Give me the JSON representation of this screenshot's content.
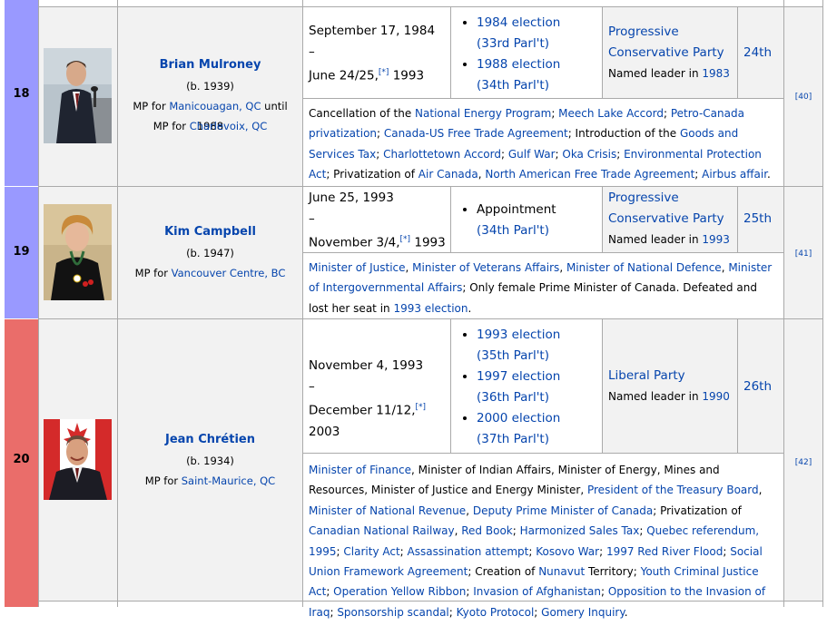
{
  "colors": {
    "pc_party": "#9999ff",
    "liberal_party": "#ea6d6a",
    "link": "#0645ad",
    "cell_bg": "#f2f2f2",
    "border": "#aaaaaa"
  },
  "rows": [
    {
      "number": "18",
      "name": "Brian Mulroney",
      "born": "(b. 1939)",
      "mp_lines": [
        {
          "prefix": "MP for ",
          "link": "Manicouagan, QC",
          "suffix": " until 1988"
        },
        {
          "prefix": "MP for ",
          "link": "Charlevoix, QC",
          "suffix": ""
        }
      ],
      "term_start": "September 17, 1984",
      "term_dash": "–",
      "term_end": "June 24/25,",
      "term_end_sup": "[*]",
      "term_end_year": " 1993",
      "elections": [
        {
          "election": "1984 election",
          "parl": "(33rd Parl't)"
        },
        {
          "election": "1988 election",
          "parl": "(34th Parl't)"
        }
      ],
      "party": "Progressive Conservative Party",
      "leader_prefix": "Named leader in ",
      "leader_year": "1983",
      "ministry": "24th",
      "ref": "[40]",
      "notes": [
        {
          "t": "Cancellation of the ",
          "l": false
        },
        {
          "t": "National Energy Program",
          "l": true
        },
        {
          "t": "; ",
          "l": false
        },
        {
          "t": "Meech Lake Accord",
          "l": true
        },
        {
          "t": "; ",
          "l": false
        },
        {
          "t": "Petro-Canada privatization",
          "l": true
        },
        {
          "t": "; ",
          "l": false
        },
        {
          "t": "Canada-US Free Trade Agreement",
          "l": true
        },
        {
          "t": "; Introduction of the ",
          "l": false
        },
        {
          "t": "Goods and Services Tax",
          "l": true
        },
        {
          "t": "; ",
          "l": false
        },
        {
          "t": "Charlottetown Accord",
          "l": true
        },
        {
          "t": "; ",
          "l": false
        },
        {
          "t": "Gulf War",
          "l": true
        },
        {
          "t": "; ",
          "l": false
        },
        {
          "t": "Oka Crisis",
          "l": true
        },
        {
          "t": "; ",
          "l": false
        },
        {
          "t": "Environmental Protection Act",
          "l": true
        },
        {
          "t": "; Privatization of ",
          "l": false
        },
        {
          "t": "Air Canada",
          "l": true
        },
        {
          "t": ", ",
          "l": false
        },
        {
          "t": "North American Free Trade Agreement",
          "l": true
        },
        {
          "t": "; ",
          "l": false
        },
        {
          "t": "Airbus affair",
          "l": true
        },
        {
          "t": ".",
          "l": false
        }
      ]
    },
    {
      "number": "19",
      "name": "Kim Campbell",
      "born": "(b. 1947)",
      "mp_lines": [
        {
          "prefix": "MP for ",
          "link": "Vancouver Centre, BC",
          "suffix": ""
        }
      ],
      "term_start": "June 25, 1993",
      "term_dash": "–",
      "term_end": "November 3/4,",
      "term_end_sup": "[*]",
      "term_end_year": " 1993",
      "elections": [
        {
          "election": "Appointment",
          "election_plain": true,
          "parl": "(34th Parl't)"
        }
      ],
      "party": "Progressive Conservative Party",
      "leader_prefix": "Named leader in ",
      "leader_year": "1993",
      "ministry": "25th",
      "ref": "[41]",
      "notes": [
        {
          "t": "Minister of Justice",
          "l": true
        },
        {
          "t": ", ",
          "l": false
        },
        {
          "t": "Minister of Veterans Affairs",
          "l": true
        },
        {
          "t": ", ",
          "l": false
        },
        {
          "t": "Minister of National Defence",
          "l": true
        },
        {
          "t": ", ",
          "l": false
        },
        {
          "t": "Minister of Intergovernmental Affairs",
          "l": true
        },
        {
          "t": "; Only female Prime Minister of Canada. Defeated and lost her seat in ",
          "l": false
        },
        {
          "t": "1993 election",
          "l": true
        },
        {
          "t": ".",
          "l": false
        }
      ]
    },
    {
      "number": "20",
      "name": "Jean Chrétien",
      "born": "(b. 1934)",
      "mp_lines": [
        {
          "prefix": "MP for ",
          "link": "Saint-Maurice, QC",
          "suffix": ""
        }
      ],
      "term_start": "November 4, 1993",
      "term_dash": "–",
      "term_end": "December 11/12,",
      "term_end_sup": "[*]",
      "term_end_year": " 2003",
      "elections": [
        {
          "election": "1993 election",
          "parl": "(35th Parl't)"
        },
        {
          "election": "1997 election",
          "parl": "(36th Parl't)"
        },
        {
          "election": "2000 election",
          "parl": "(37th Parl't)"
        }
      ],
      "party": "Liberal Party",
      "leader_prefix": "Named leader in ",
      "leader_year": "1990",
      "ministry": "26th",
      "ref": "[42]",
      "notes": [
        {
          "t": "Minister of Finance",
          "l": true
        },
        {
          "t": ", Minister of Indian Affairs, Minister of Energy, Mines and Resources, Minister of Justice and Energy Minister, ",
          "l": false
        },
        {
          "t": "President of the Treasury Board",
          "l": true
        },
        {
          "t": ", ",
          "l": false
        },
        {
          "t": "Minister of National Revenue",
          "l": true
        },
        {
          "t": ", ",
          "l": false
        },
        {
          "t": "Deputy Prime Minister of Canada",
          "l": true
        },
        {
          "t": "; Privatization of ",
          "l": false
        },
        {
          "t": "Canadian National Railway",
          "l": true
        },
        {
          "t": ", ",
          "l": false
        },
        {
          "t": "Red Book",
          "l": true
        },
        {
          "t": "; ",
          "l": false
        },
        {
          "t": "Harmonized Sales Tax",
          "l": true
        },
        {
          "t": "; ",
          "l": false
        },
        {
          "t": "Quebec referendum, 1995",
          "l": true
        },
        {
          "t": "; ",
          "l": false
        },
        {
          "t": "Clarity Act",
          "l": true
        },
        {
          "t": "; ",
          "l": false
        },
        {
          "t": "Assassination attempt",
          "l": true
        },
        {
          "t": "; ",
          "l": false
        },
        {
          "t": "Kosovo War",
          "l": true
        },
        {
          "t": "; ",
          "l": false
        },
        {
          "t": "1997 Red River Flood",
          "l": true
        },
        {
          "t": "; ",
          "l": false
        },
        {
          "t": "Social Union Framework Agreement",
          "l": true
        },
        {
          "t": "; Creation of ",
          "l": false
        },
        {
          "t": "Nunavut",
          "l": true
        },
        {
          "t": " Territory; ",
          "l": false
        },
        {
          "t": "Youth Criminal Justice Act",
          "l": true
        },
        {
          "t": "; ",
          "l": false
        },
        {
          "t": "Operation Yellow Ribbon",
          "l": true
        },
        {
          "t": "; ",
          "l": false
        },
        {
          "t": "Invasion of Afghanistan",
          "l": true
        },
        {
          "t": "; ",
          "l": false
        },
        {
          "t": "Opposition to the Invasion of Iraq",
          "l": true
        },
        {
          "t": "; ",
          "l": false
        },
        {
          "t": "Sponsorship scandal",
          "l": true
        },
        {
          "t": "; ",
          "l": false
        },
        {
          "t": "Kyoto Protocol",
          "l": true
        },
        {
          "t": "; ",
          "l": false
        },
        {
          "t": "Gomery Inquiry",
          "l": true
        },
        {
          "t": ".",
          "l": false
        }
      ]
    }
  ]
}
